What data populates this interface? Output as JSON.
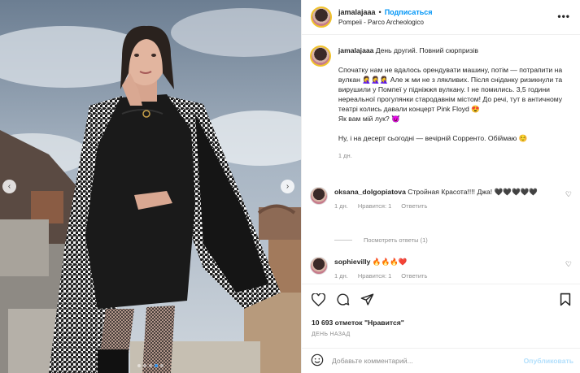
{
  "header": {
    "username": "jamalajaaa",
    "separator": "•",
    "follow_label": "Подписаться",
    "location": "Pompeii - Parco Archeologico",
    "more_icon": "ellipsis-icon"
  },
  "caption": {
    "username": "jamalajaaa",
    "title": "День другий. Повний сюрпризів",
    "paragraph1": "Спочатку нам не вдалось орендувати машину, потім — потрапити на вулкан 🤦‍♀️🤦‍♀️🤦‍♀️ Але ж ми не з лякливих. Після сніданку ризикнули та вирушили у Помпеї у підніжжя вулкану. І не помились. 3,5 години нереальної прогулянки стародавнім містом! До речі, тут в античному театрі колись давали концерт Pink Floyd 😍",
    "paragraph1_end": "Як вам мій лук? 😈",
    "paragraph2": "Ну, і на десерт сьогодні — вечірній Сорренто. Обіймаю ☺️",
    "time": "1 дн."
  },
  "comments": [
    {
      "username": "oksana_dolgopiatova",
      "text": "Стройная Красота!!!! Джа! 🖤🖤🖤🖤🖤",
      "time": "1 дн.",
      "likes": "Нравится: 1",
      "reply": "Ответить"
    },
    {
      "username": "sophievilly",
      "text": "🔥🔥🔥❤️",
      "time": "1 дн.",
      "likes": "Нравится: 1",
      "reply": "Ответить"
    }
  ],
  "view_replies": "Посмотреть ответы (1)",
  "actions": {
    "like_icon": "heart-icon",
    "comment_icon": "comment-icon",
    "share_icon": "share-icon",
    "save_icon": "bookmark-icon"
  },
  "likes_text": "10 693 отметок \"Нравится\"",
  "posted_ago": "ДЕНЬ НАЗАД",
  "add_comment": {
    "placeholder": "Добавьте комментарий...",
    "emoji_icon": "smile-icon",
    "publish_label": "Опубликовать"
  },
  "carousel": {
    "prev_icon": "chevron-left-icon",
    "next_icon": "chevron-right-icon",
    "current": 4,
    "total": 5
  },
  "colors": {
    "accent": "#0095f6",
    "publish_disabled": "#b2dffc",
    "muted": "#8e8e8e"
  }
}
